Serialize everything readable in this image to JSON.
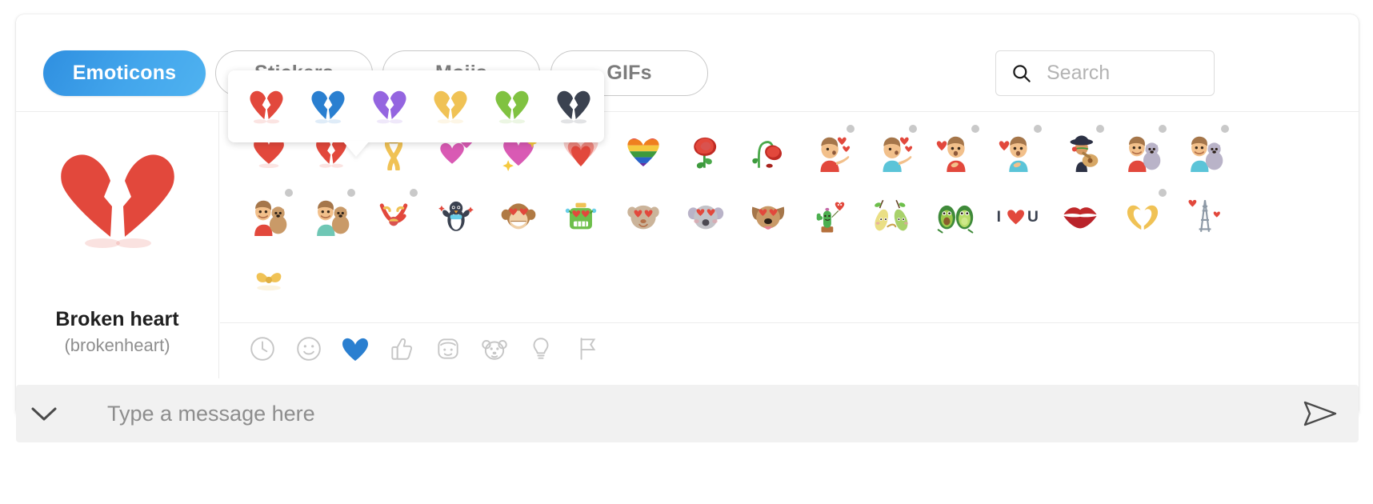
{
  "window": {
    "background": "#ffffff"
  },
  "tabs": [
    {
      "label": "Emoticons",
      "active": true,
      "name": "tab-emoticons"
    },
    {
      "label": "Stickers",
      "active": false,
      "name": "tab-stickers"
    },
    {
      "label": "Mojis",
      "active": false,
      "name": "tab-mojis"
    },
    {
      "label": "GIFs",
      "active": false,
      "name": "tab-gifs"
    }
  ],
  "search": {
    "placeholder": "Search",
    "value": "",
    "icon": "search-icon"
  },
  "preview": {
    "name": "Broken heart",
    "shortcode": "(brokenheart)",
    "color": "#e2483c"
  },
  "variant_popup": {
    "visible": true,
    "for_emoticon": "Broken heart",
    "colors": [
      "#e2483c",
      "#2a7fd0",
      "#9465e0",
      "#f3c košt"
    ],
    "swatches": [
      {
        "name": "variant-red",
        "color": "#e2483c"
      },
      {
        "name": "variant-blue",
        "color": "#2a7fd0"
      },
      {
        "name": "variant-purple",
        "color": "#9465e0"
      },
      {
        "name": "variant-yellow",
        "color": "#f0c255"
      },
      {
        "name": "variant-green",
        "color": "#80c241"
      },
      {
        "name": "variant-dark",
        "color": "#3b4250"
      }
    ]
  },
  "grid": {
    "rows": [
      [
        {
          "name": "red-heart-emoticon",
          "glyph": "❤️",
          "dot": true
        },
        {
          "name": "broken-heart-emoticon",
          "glyph": "💔",
          "dot": true
        },
        {
          "name": "ribbon-emoticon",
          "glyph": "🎗️",
          "dot": true
        },
        {
          "name": "two-hearts-emoticon",
          "glyph": "💕",
          "dot": false
        },
        {
          "name": "sparkling-heart-emoticon",
          "glyph": "💖",
          "dot": false
        },
        {
          "name": "growing-heart-emoticon",
          "glyph": "💗",
          "dot": false
        },
        {
          "name": "rainbow-heart-emoticon",
          "glyph": "🏳️‍🌈",
          "dot": false
        },
        {
          "name": "rose-emoticon",
          "glyph": "🌹",
          "dot": false
        },
        {
          "name": "wilted-rose-emoticon",
          "glyph": "🥀",
          "dot": false
        },
        {
          "name": "woman-blowing-kiss-emoticon",
          "glyph": "😘",
          "dot": true
        },
        {
          "name": "man-blowing-kiss-emoticon",
          "glyph": "😘",
          "dot": true
        },
        {
          "name": "woman-heart-hand-emoticon",
          "glyph": "🫶",
          "dot": true
        },
        {
          "name": "man-heart-hand-emoticon",
          "glyph": "🫶",
          "dot": true
        },
        {
          "name": "mariachi-serenade-emoticon",
          "glyph": "🎸",
          "dot": true
        },
        {
          "name": "woman-with-cat-emoticon",
          "glyph": "🐱",
          "dot": true
        },
        {
          "name": "man-with-cat-emoticon",
          "glyph": "🐱",
          "dot": true
        }
      ],
      [
        {
          "name": "woman-with-dog-emoticon",
          "glyph": "🐶",
          "dot": true
        },
        {
          "name": "man-with-dog-emoticon",
          "glyph": "🐶",
          "dot": true
        },
        {
          "name": "acrobat-emoticon",
          "glyph": "🤸",
          "dot": true
        },
        {
          "name": "penguin-in-love-emoticon",
          "glyph": "🐧",
          "dot": false
        },
        {
          "name": "heart-eyes-monkey-emoticon",
          "glyph": "🐵",
          "dot": false
        },
        {
          "name": "robot-in-love-emoticon",
          "glyph": "🤖",
          "dot": false
        },
        {
          "name": "heart-eyes-cat-emoticon",
          "glyph": "😻",
          "dot": false
        },
        {
          "name": "heart-eyes-koala-emoticon",
          "glyph": "🐨",
          "dot": false
        },
        {
          "name": "heart-eyes-dog-emoticon",
          "glyph": "🐕",
          "dot": false
        },
        {
          "name": "cactus-love-emoticon",
          "glyph": "🌵",
          "dot": false
        },
        {
          "name": "hugging-pears-emoticon",
          "glyph": "🍐",
          "dot": false
        },
        {
          "name": "avocado-couple-emoticon",
          "glyph": "🥑",
          "dot": false
        },
        {
          "name": "i-love-you-emoticon",
          "glyph": "💌",
          "dot": false
        },
        {
          "name": "kiss-mark-emoticon",
          "glyph": "💋",
          "dot": false
        },
        {
          "name": "heart-hands-emoticon",
          "glyph": "🫰",
          "dot": true
        },
        {
          "name": "eiffel-tower-love-emoticon",
          "glyph": "🗼",
          "dot": false
        }
      ],
      [
        {
          "name": "ribbon-bow-emoticon",
          "glyph": "🎀",
          "dot": false
        }
      ]
    ]
  },
  "categories": [
    {
      "name": "category-recent",
      "icon": "clock-icon",
      "active": false
    },
    {
      "name": "category-smileys",
      "icon": "smiley-icon",
      "active": false
    },
    {
      "name": "category-love",
      "icon": "heart-icon",
      "active": true
    },
    {
      "name": "category-gestures",
      "icon": "thumbs-up-icon",
      "active": false
    },
    {
      "name": "category-people",
      "icon": "person-face-icon",
      "active": false
    },
    {
      "name": "category-animals",
      "icon": "animal-face-icon",
      "active": false
    },
    {
      "name": "category-objects",
      "icon": "lightbulb-icon",
      "active": false
    },
    {
      "name": "category-flags",
      "icon": "flag-icon",
      "active": false
    }
  ],
  "message_bar": {
    "placeholder": "Type a message here",
    "value": "",
    "expand_icon": "chevron-down-icon",
    "send_icon": "send-icon"
  },
  "colors": {
    "accent": "#3b8fe0",
    "active_category": "#2a7fd0",
    "heart_red": "#e2483c",
    "panel_bg": "#ffffff",
    "msgbar_bg": "#f1f1f1",
    "border": "#ececec"
  }
}
